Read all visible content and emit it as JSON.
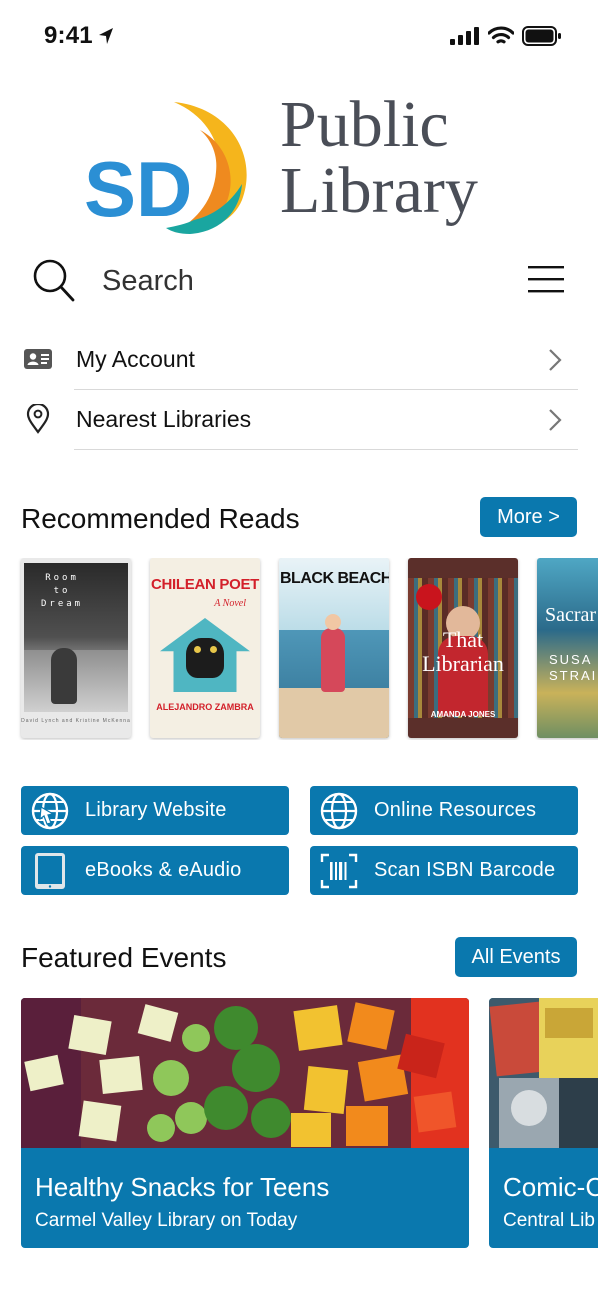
{
  "status_bar": {
    "time": "9:41"
  },
  "logo": {
    "mark_text": "SD",
    "line1": "Public",
    "line2": "Library"
  },
  "search": {
    "placeholder": "Search"
  },
  "nav": [
    {
      "label": "My Account",
      "icon": "account-card-icon"
    },
    {
      "label": "Nearest Libraries",
      "icon": "location-pin-icon"
    }
  ],
  "recommended": {
    "title": "Recommended Reads",
    "more_label": "More >",
    "books": [
      {
        "title_lines": [
          "Room",
          "to",
          "Dream"
        ],
        "author": "David Lynch and Kristine McKenna"
      },
      {
        "title": "CHILEAN POET",
        "subtitle": "A Novel",
        "author": "ALEJANDRO ZAMBRA"
      },
      {
        "title": "BLACK BEACH"
      },
      {
        "title_lines": [
          "That",
          "Librarian"
        ],
        "author": "AMANDA JONES"
      },
      {
        "title": "Sacrar",
        "author": "SUSA STRAI"
      }
    ]
  },
  "quick_actions": [
    {
      "label": "Library Website",
      "icon": "globe-cursor-icon"
    },
    {
      "label": "Online Resources",
      "icon": "globe-icon"
    },
    {
      "label": "eBooks & eAudio",
      "icon": "tablet-icon"
    },
    {
      "label": "Scan ISBN Barcode",
      "icon": "barcode-scan-icon"
    }
  ],
  "events": {
    "title": "Featured Events",
    "all_label": "All Events",
    "items": [
      {
        "title": "Healthy Snacks for Teens",
        "subtitle": "Carmel Valley Library on Today"
      },
      {
        "title": "Comic-C",
        "subtitle": "Central Lib"
      }
    ]
  },
  "colors": {
    "accent": "#0a78ae",
    "logo_blue": "#2b8fd4",
    "logo_yellow": "#f5b51c",
    "logo_orange": "#ef8a1f",
    "logo_teal": "#1aa6a0",
    "text_grey": "#4a4e57"
  }
}
